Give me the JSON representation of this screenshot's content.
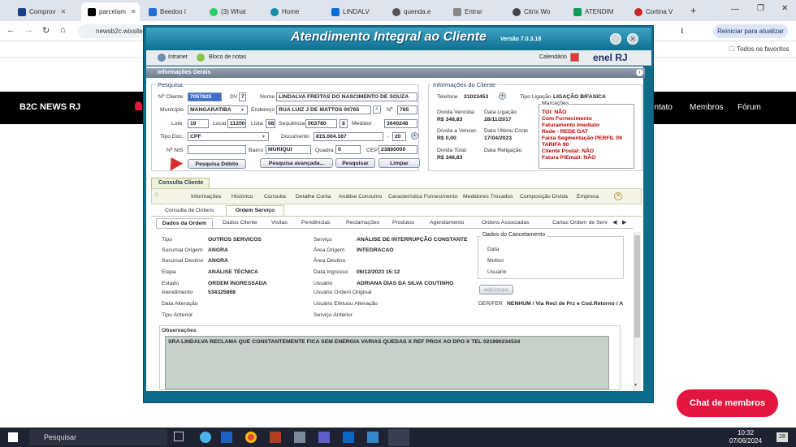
{
  "browser": {
    "tabs": [
      "Comprov",
      "parcelam",
      "Beedoo I",
      "(3) What",
      "Home",
      "LINDALV",
      "quenda.e",
      "Entrar",
      "Citrix Wo",
      "ATENDIM",
      "Cortina V"
    ],
    "new_tab": "+",
    "url": "newsb2c.wixsite",
    "update_button": "Reiniciar para atualizar",
    "favorites": "Todos os favoritos"
  },
  "site": {
    "logo": "B2C NEWS RJ",
    "nav": [
      "ontato",
      "Membros",
      "Fórum"
    ],
    "chat_button": "Chat de membros"
  },
  "app": {
    "title": "Atendimento Integral ao Cliente",
    "version": "Versão 7.0.3.18",
    "toolbar": {
      "intranet": "Intranet",
      "notes": "Bloco de notas",
      "calendar": "Calendário",
      "brand": "enel RJ"
    },
    "section_header": "Informações Gerais",
    "pesquisa": {
      "title": "Pesquisa",
      "num_cliente_label": "Nº Cliente",
      "num_cliente": "7057825",
      "dv_label": "DV",
      "dv": "7",
      "nome_label": "Nome",
      "nome": "LINDALVA FREITAS DO NASCIMENTO DE SOUZA",
      "municipio_label": "Município",
      "municipio": "MANGARATIBA",
      "endereco_label": "Endereço",
      "endereco": "RUA LUIZ J DE MATTOS 00765",
      "numero_label": "Nº",
      "numero": "765",
      "lote_label": "Lote",
      "lote": "19",
      "local_label": "Local",
      "local": "11200",
      "lista_label": "Lista",
      "lista": "08",
      "sequencia_label": "Sequência",
      "sequencia": "003780",
      "seq2": "8",
      "medidor_label": "Medidor",
      "medidor": "3640248",
      "tipodoc_label": "Tipo Doc.",
      "tipodoc": "CPF",
      "documento_label": "Documento",
      "documento": "815.004.167",
      "doc_sep": "-",
      "doc_dv": "20",
      "nis_label": "Nº NIS",
      "bairro_label": "Bairro",
      "bairro": "MURIQUI",
      "quadra_label": "Quadra",
      "quadra": "0",
      "cep_label": "CEP",
      "cep": "23860000",
      "btn_debito": "Pesquisa Débito",
      "btn_avancada": "Pesquisa avançada...",
      "btn_pesquisar": "Pesquisar",
      "btn_limpar": "Limpar"
    },
    "info_cliente": {
      "title": "Informações do Cliente",
      "telefone_label": "Telefone",
      "telefone": "21023453",
      "tipo_ligacao_label": "Tipo Ligação",
      "tipo_ligacao": "LIGAÇÃO BIFASICA",
      "divida_vencida_label": "Dívida Vencida:",
      "divida_vencida": "R$ 348,83",
      "data_ligacao_label": "Data Ligação",
      "data_ligacao": "28/11/2017",
      "divida_vencer_label": "Dívida a Vencer:",
      "divida_vencer": "R$ 0,00",
      "data_corte_label": "Data Último Corte",
      "data_corte": "17/04/2023",
      "divida_total_label": "Dívida Total:",
      "divida_total": "R$ 348,83",
      "data_religacao_label": "Data Religação",
      "marcacoes_title": "Marcações",
      "marcacoes": [
        "TOI: NÃO",
        "Com Fornecimento",
        "Faturamento Imediato",
        "Rede - REDE DAT",
        "Faixa Segmentação PERFIL 09",
        "TARIFA 90",
        "Cliente Postal: NÃO",
        "Fatura P/Email: NÃO"
      ]
    },
    "consulta_tab": "Consulta Cliente",
    "main_tabs": [
      "Informações",
      "Histórico",
      "Consulta",
      "Detalhe Conta",
      "Análise Consumo",
      "Característica Fornecimento",
      "Medidores Trocados",
      "Composição Dívida",
      "Empresa"
    ],
    "sub_tabs": [
      "Consulta de Ordens",
      "Ordem Serviço"
    ],
    "order_tabs": [
      "Dados da Ordem",
      "Dados Cliente",
      "Visitas",
      "Pendências",
      "Reclamações",
      "Produtos",
      "Agendamento",
      "Ordens Associadas",
      "Cartas Ordem de Serv"
    ],
    "ordem": {
      "tipo_label": "Tipo",
      "tipo": "OUTROS SERVICOS",
      "servico_label": "Serviço",
      "servico": "ANÁLISE DE INTERRUPÇÃO CONSTANTE",
      "suc_origem_label": "Sucursal Origem",
      "suc_origem": "ANGRA",
      "area_origem_label": "Área Origem",
      "area_origem": "INTEGRACAO",
      "suc_destino_label": "Sucursal Destino",
      "suc_destino": "ANGRA",
      "area_destino_label": "Área Destino",
      "etapa_label": "Etapa",
      "etapa": "ANÁLISE TÉCNICA",
      "data_ingresso_label": "Data Ingresso",
      "data_ingresso": "06/12/2023 15:12",
      "estado_label": "Estado",
      "estado": "ORDEM INGRESSADA",
      "usuario_label": "Usuário",
      "usuario": "ADRIANA DIAS DA SILVA COUTINHO",
      "atendimento_label": "Atendimento",
      "atendimento": "534325868",
      "usuario_origem_label": "Usuário Ordem Original",
      "data_alteracao_label": "Data Alteração",
      "usuario_alteracao_label": "Usuário Efetuou Alteração",
      "tipo_anterior_label": "Tipo Anterior",
      "servico_anterior_label": "Serviço Anterior",
      "cancel_title": "Dados do Cancelamento",
      "cancel_data": "Data",
      "cancel_motivo": "Motivo",
      "cancel_usuario": "Usuário",
      "btn_adicionais": "Adicionais",
      "der_label": "DER/FER",
      "der": "NENHUM / Via Recl de Prz e Cod.Retorno / A",
      "obs_label": "Observações",
      "obs": "SRA LINDALVA   RECLAMA QUE CONSTANTEMENTE  FICA  SEM ENERGIA VARIAS  QUEDAS  X  REF  PROX AO DPO   X  TEL  021990234534"
    }
  },
  "taskbar": {
    "search": "Pesquisar",
    "time": "10:32",
    "date": "07/06/2024",
    "badge": "28"
  }
}
